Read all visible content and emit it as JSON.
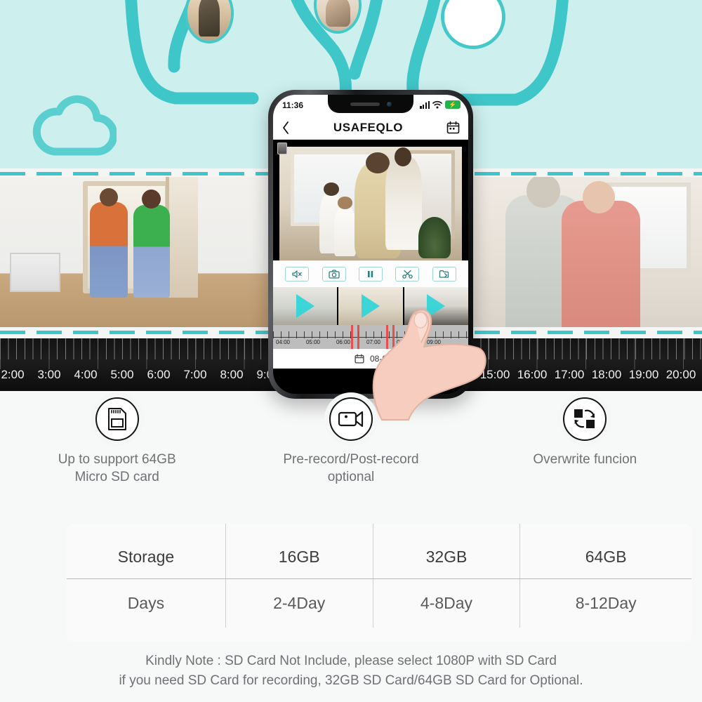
{
  "theme": {
    "hero_bg": "#cdf0ef",
    "teal": "#3fc6c9",
    "teal_dark": "#45c8c8",
    "page_bg": "#f7f8f8",
    "timeline_bg": "#131313",
    "accent_red": "#ef3b3b",
    "battery_green": "#24b24b"
  },
  "hero": {
    "cloud_icon": "cloud-icon",
    "badges": [
      {
        "name": "photo-badge-delivery"
      },
      {
        "name": "photo-badge-family"
      },
      {
        "name": "photo-badge-empty"
      }
    ]
  },
  "photo_strip": {
    "left_scene": "couple-entering-door",
    "right_scene": "elderly-couple-hugging"
  },
  "timeline": {
    "left_labels": [
      "2:00",
      "3:00",
      "4:00",
      "5:00",
      "6:00",
      "7:00",
      "8:00",
      "9:00"
    ],
    "right_labels": [
      "15:00",
      "16:00",
      "17:00",
      "18:00",
      "19:00",
      "20:00"
    ]
  },
  "phone": {
    "status_bar": {
      "time": "11:36",
      "signal_icon": "signal-bars-icon",
      "wifi_icon": "wifi-icon",
      "battery_icon": "battery-charging-icon",
      "battery_glyph": "⚡"
    },
    "app_header": {
      "back_icon": "chevron-left-icon",
      "title": "USAFEQLO",
      "calendar_icon": "calendar-icon"
    },
    "controls": [
      {
        "name": "mute-button",
        "glyph": "🔇"
      },
      {
        "name": "snapshot-button",
        "glyph": "📷"
      },
      {
        "name": "pause-button",
        "glyph": "❘❘"
      },
      {
        "name": "cut-button",
        "glyph": "✂"
      },
      {
        "name": "save-button",
        "glyph": "🗁"
      }
    ],
    "thumbnails": [
      {
        "name": "clip-thumbnail-1"
      },
      {
        "name": "clip-thumbnail-2"
      },
      {
        "name": "clip-thumbnail-3"
      }
    ],
    "mini_timeline": {
      "labels": [
        "04:00",
        "05:00",
        "06:00",
        "07:00",
        "08:00",
        "09:00"
      ]
    },
    "date_row": {
      "calendar_icon": "calendar-icon",
      "date": "08-0"
    }
  },
  "features": [
    {
      "icon": "sd-card-icon",
      "label_line1": "Up to support 64GB",
      "label_line2": "Micro SD card"
    },
    {
      "icon": "video-camera-icon",
      "label_line1": "Pre-record/Post-record",
      "label_line2": "optional"
    },
    {
      "icon": "overwrite-swap-icon",
      "label_line1": "Overwrite funcion",
      "label_line2": ""
    }
  ],
  "storage_table": {
    "header": [
      "Storage",
      "16GB",
      "32GB",
      "64GB"
    ],
    "rows": [
      [
        "Days",
        "2-4Day",
        "4-8Day",
        "8-12Day"
      ]
    ]
  },
  "note": {
    "line1": "Kindly Note : SD Card Not Include, please select 1080P with SD Card",
    "line2": "if you need SD Card for recording, 32GB SD Card/64GB SD Card for Optional."
  }
}
